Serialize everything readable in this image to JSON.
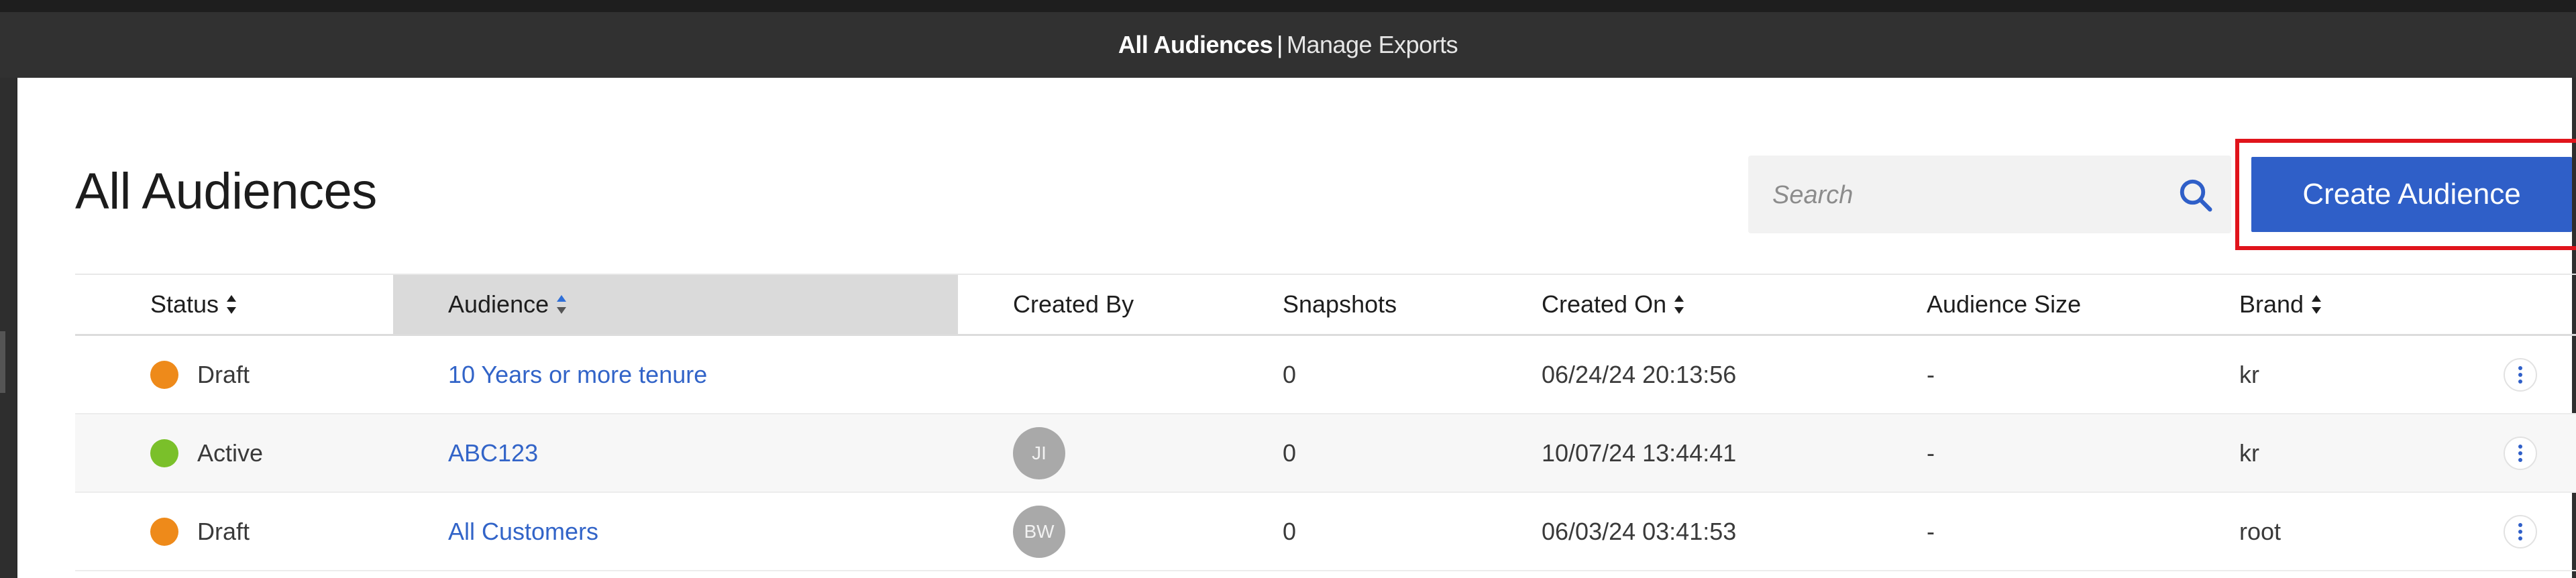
{
  "nav": {
    "active": "All Audiences",
    "separator": "|",
    "link": "Manage Exports"
  },
  "page": {
    "title": "All Audiences"
  },
  "search": {
    "placeholder": "Search",
    "icon": "search-icon"
  },
  "actions": {
    "create_label": "Create Audience"
  },
  "table": {
    "columns": {
      "status": "Status",
      "audience": "Audience",
      "created_by": "Created By",
      "snapshots": "Snapshots",
      "created_on": "Created On",
      "audience_size": "Audience Size",
      "brand": "Brand"
    },
    "rows": [
      {
        "status": "Draft",
        "status_color": "#ee8a1a",
        "audience": "10 Years or more tenure",
        "created_by": "",
        "snapshots": "0",
        "created_on": "06/24/24 20:13:56",
        "audience_size": "-",
        "brand": "kr"
      },
      {
        "status": "Active",
        "status_color": "#7ac02a",
        "audience": "ABC123",
        "created_by": "JI",
        "snapshots": "0",
        "created_on": "10/07/24 13:44:41",
        "audience_size": "-",
        "brand": "kr"
      },
      {
        "status": "Draft",
        "status_color": "#ee8a1a",
        "audience": "All Customers",
        "created_by": "BW",
        "snapshots": "0",
        "created_on": "06/03/24 03:41:53",
        "audience_size": "-",
        "brand": "root"
      }
    ]
  },
  "colors": {
    "primary": "#2f5fc8",
    "highlight": "#e0141c",
    "link": "#3264c8",
    "draft": "#ee8a1a",
    "active": "#7ac02a"
  }
}
